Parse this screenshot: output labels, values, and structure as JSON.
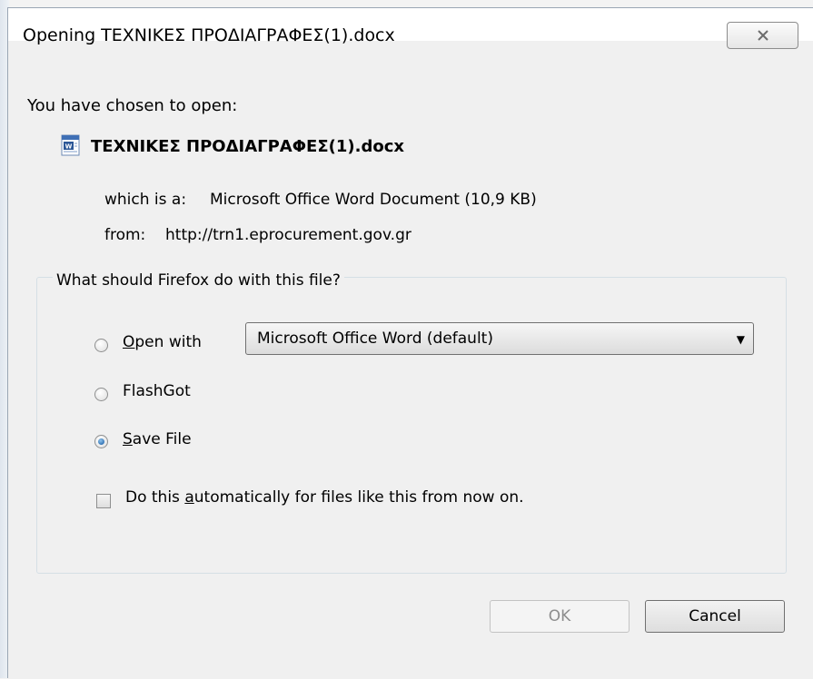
{
  "window": {
    "title": "Opening ΤΕΧΝΙΚΕΣ ΠΡΟΔΙΑΓΡΑΦΕΣ(1).docx"
  },
  "dialog": {
    "intro": "You have chosen to open:",
    "file_name": "ΤΕΧΝΙΚΕΣ ΠΡΟΔΙΑΓΡΑΦΕΣ(1).docx",
    "file_icon": "word-document-icon",
    "type_label": "which is a:",
    "type_value": "Microsoft Office Word Document (10,9 KB)",
    "from_label": "from:",
    "from_value": "http://trn1.eprocurement.gov.gr"
  },
  "actions": {
    "legend": "What should Firefox do with this file?",
    "open_with": {
      "accel": "O",
      "rest": "pen with",
      "selected": false
    },
    "open_with_select_value": "Microsoft Office Word (default)",
    "flashgot": {
      "label": "FlashGot",
      "selected": false
    },
    "save_file": {
      "accel": "S",
      "rest": "ave File",
      "selected": true
    },
    "auto_checkbox": {
      "pre": "Do this ",
      "accel": "a",
      "rest": "utomatically for files like this from now on.",
      "checked": false
    }
  },
  "buttons": {
    "ok": "OK",
    "cancel": "Cancel"
  }
}
